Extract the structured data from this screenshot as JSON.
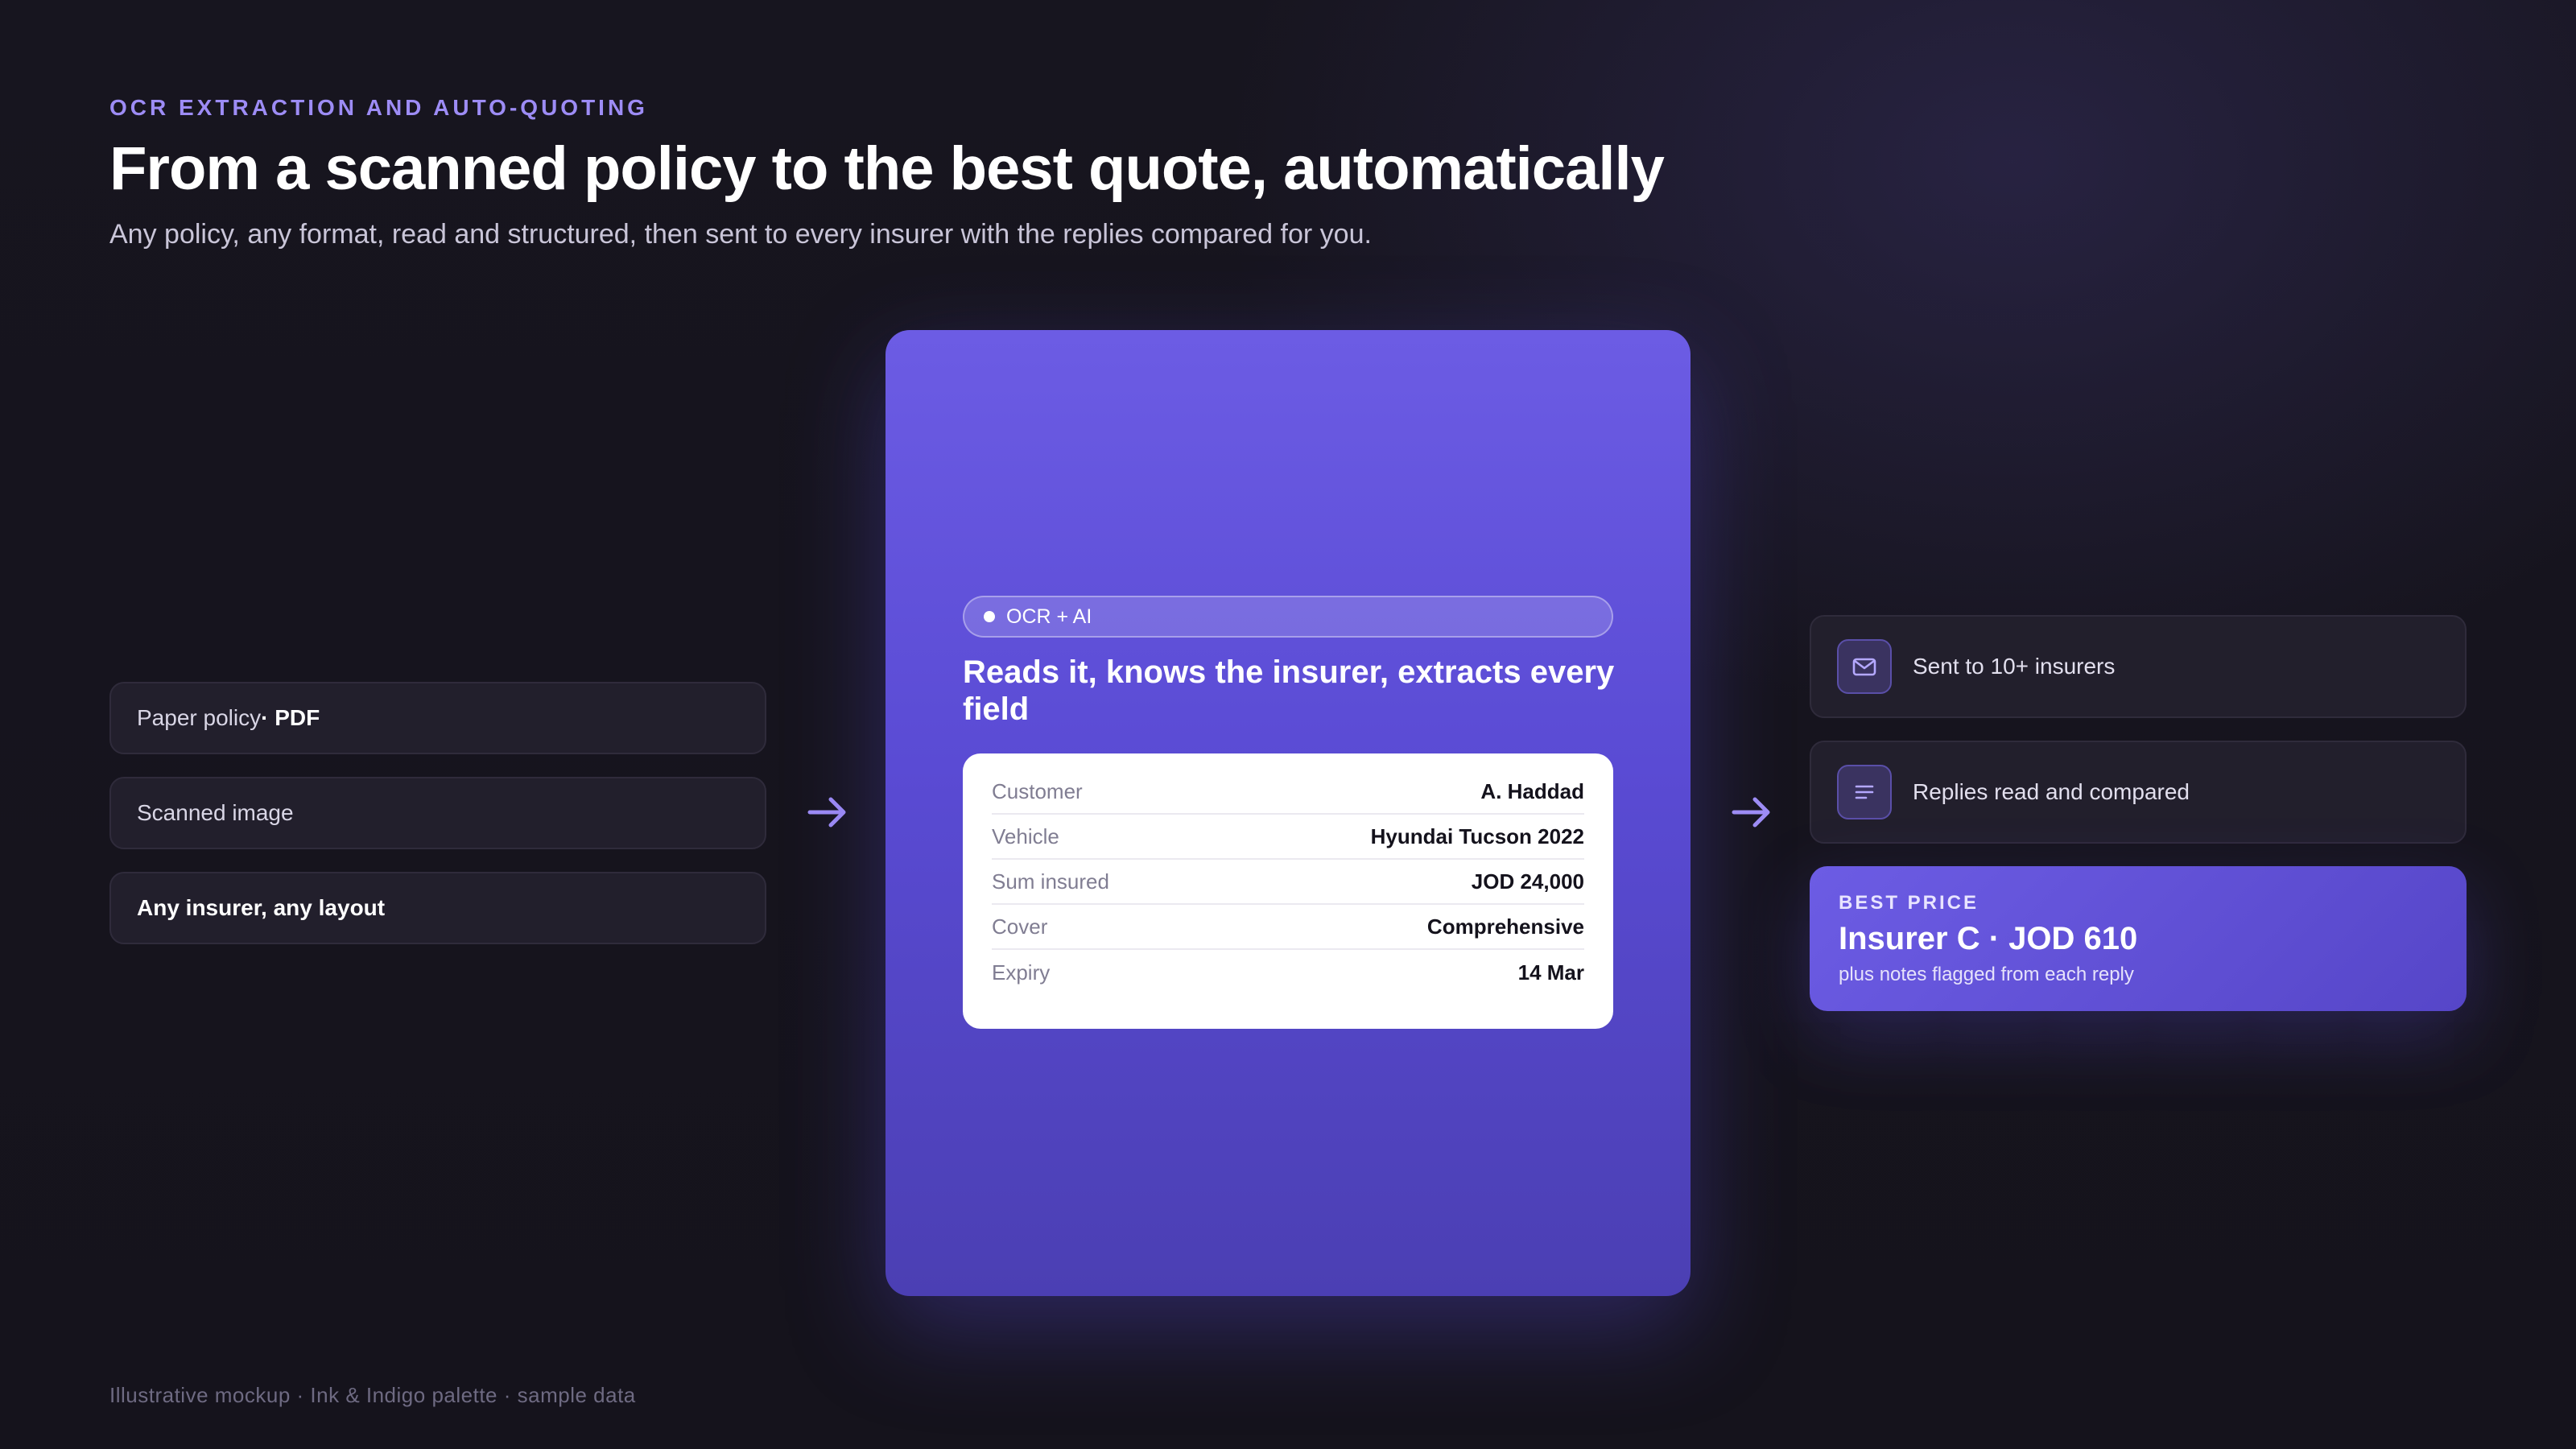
{
  "header": {
    "eyebrow": "OCR EXTRACTION AND AUTO-QUOTING",
    "title": "From a scanned policy to the best quote, automatically",
    "subtitle": "Any policy, any format, read and structured, then sent to every insurer with the replies compared for you."
  },
  "inputs": [
    {
      "label": "Paper policy",
      "strong": " · PDF"
    },
    {
      "label": "Scanned image"
    },
    {
      "label": "Any insurer, any layout"
    }
  ],
  "processor": {
    "badge": "OCR + AI",
    "heading": "Reads it, knows the insurer, extracts every field",
    "fields": [
      {
        "key": "Customer",
        "value": "A. Haddad"
      },
      {
        "key": "Vehicle",
        "value": "Hyundai Tucson 2022"
      },
      {
        "key": "Sum insured",
        "value": "JOD 24,000"
      },
      {
        "key": "Cover",
        "value": "Comprehensive"
      },
      {
        "key": "Expiry",
        "value": "14 Mar"
      }
    ]
  },
  "outputs": [
    {
      "label": "Sent to 10+ insurers",
      "icon": "mail-icon"
    },
    {
      "label": "Replies read and compared",
      "icon": "list-icon"
    }
  ],
  "best": {
    "label": "BEST PRICE",
    "value": "Insurer C · JOD 610",
    "note": "plus notes flagged from each reply"
  },
  "footer": "Illustrative mockup · Ink & Indigo palette · sample data",
  "colors": {
    "background": "#17151f",
    "accent": "#6c5ce4",
    "eyebrow": "#9d8cf5"
  }
}
